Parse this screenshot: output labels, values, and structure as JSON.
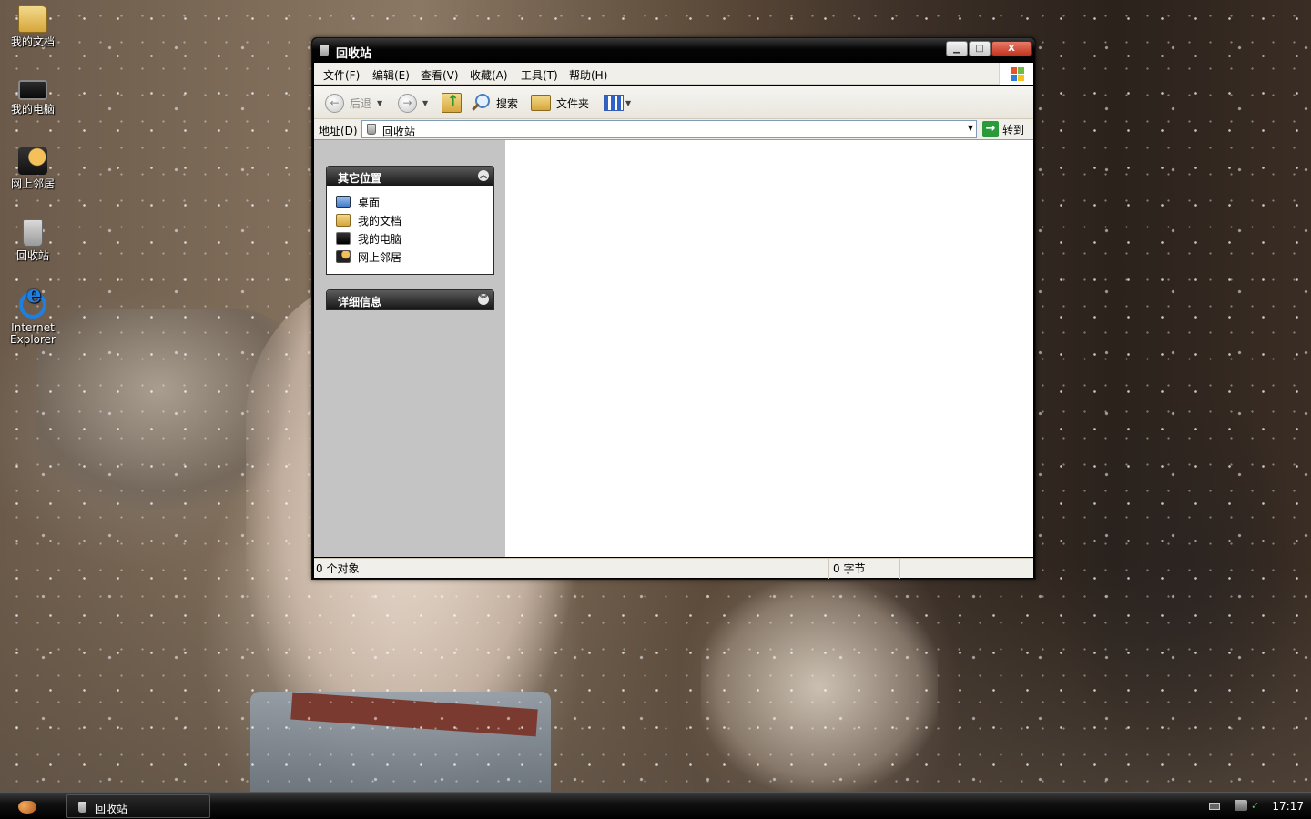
{
  "desktop": {
    "icons": [
      {
        "label": "我的文档",
        "icon": "my-documents-icon"
      },
      {
        "label": "我的电脑",
        "icon": "my-computer-icon"
      },
      {
        "label": "网上邻居",
        "icon": "network-places-icon"
      },
      {
        "label": "回收站",
        "icon": "recycle-bin-icon"
      },
      {
        "label": "Internet Explorer",
        "icon": "internet-explorer-icon"
      }
    ]
  },
  "window": {
    "title": "回收站",
    "caption_buttons": {
      "minimize": "▁",
      "maximize": "□",
      "close": "X"
    },
    "menu": [
      {
        "label": "文件(F)"
      },
      {
        "label": "编辑(E)"
      },
      {
        "label": "查看(V)"
      },
      {
        "label": "收藏(A)"
      },
      {
        "label": "工具(T)"
      },
      {
        "label": "帮助(H)"
      }
    ],
    "toolbar": {
      "back_label": "后退",
      "search_label": "搜索",
      "folders_label": "文件夹",
      "back_glyph": "←",
      "forward_glyph": "→",
      "dropdown_glyph": "▼"
    },
    "address": {
      "label": "地址(D)",
      "value": "回收站",
      "go_label": "转到",
      "go_glyph": "→",
      "dropdown_glyph": "▼"
    },
    "task_pane": {
      "other_places": {
        "title": "其它位置",
        "chevron": "︽",
        "links": [
          {
            "label": "桌面",
            "icon": "desktop-icon"
          },
          {
            "label": "我的文档",
            "icon": "my-documents-icon"
          },
          {
            "label": "我的电脑",
            "icon": "my-computer-icon"
          },
          {
            "label": "网上邻居",
            "icon": "network-places-icon"
          }
        ]
      },
      "details": {
        "title": "详细信息",
        "chevron": "︾"
      }
    },
    "status": {
      "objects": "0 个对象",
      "size": "0 字节"
    }
  },
  "taskbar": {
    "task_label": "回收站",
    "time": "17:17"
  },
  "colors": {
    "titlebar": "#000000",
    "menubar": "#f1efe9",
    "taskpane": "#c4c4c4",
    "go_button": "#2a9a3a"
  }
}
